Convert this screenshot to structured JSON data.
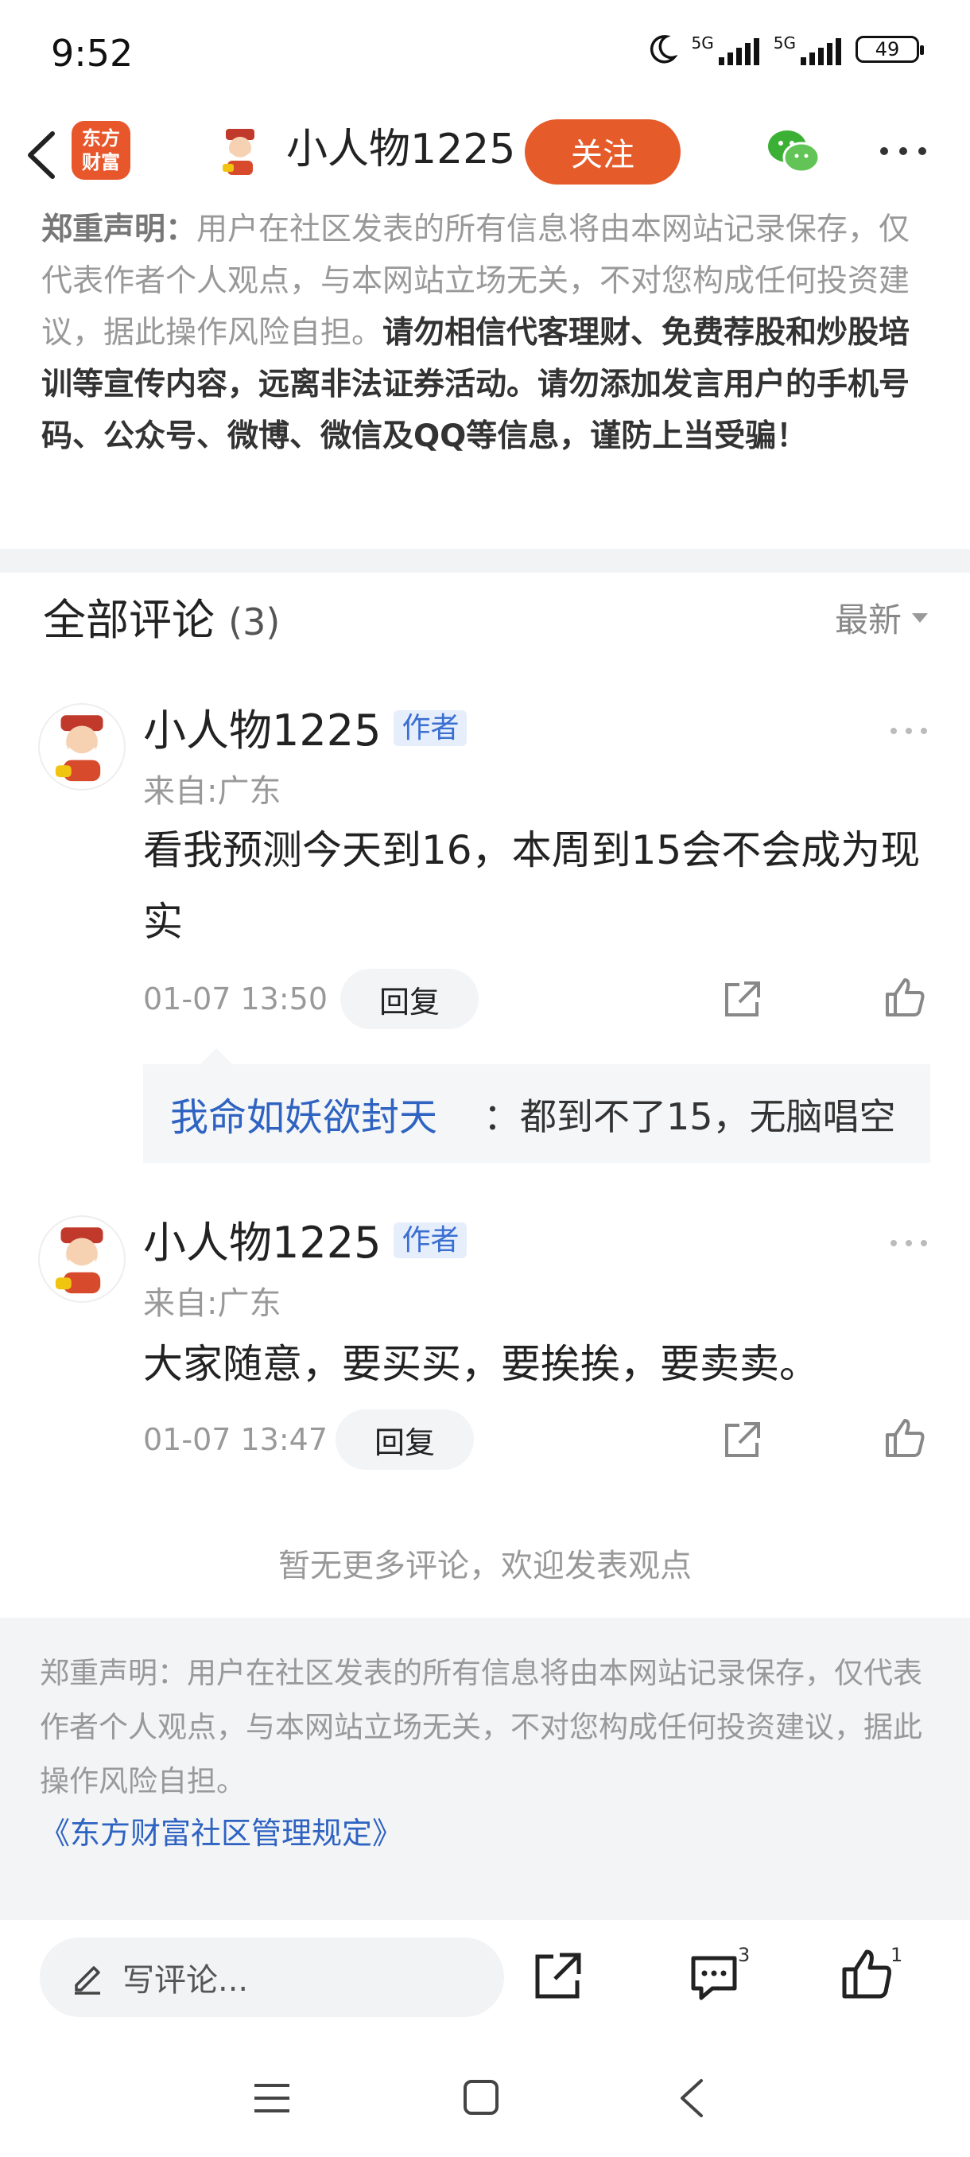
{
  "status_bar": {
    "time": "9:52",
    "network_1": "5G",
    "network_2": "5G",
    "battery": "49"
  },
  "header": {
    "logo_line1": "东方",
    "logo_line2": "财富",
    "username": "小人物1225",
    "follow_label": "关注"
  },
  "disclaimer_top": {
    "lead": "郑重声明：",
    "gray_text": "用户在社区发表的所有信息将由本网站记录保存，仅代表作者个人观点，与本网站立场无关，不对您构成任何投资建议，据此操作风险自担。",
    "dark_text": "请勿相信代客理财、免费荐股和炒股培训等宣传内容，远离非法证券活动。请勿添加发言用户的手机号码、公众号、微博、微信及QQ等信息，谨防上当受骗！"
  },
  "comments_section": {
    "title": "全部评论",
    "count": "(3)",
    "sort_label": "最新"
  },
  "comments": [
    {
      "name": "小人物1225",
      "badge": "作者",
      "location": "来自:广东",
      "text": "看我预测今天到16，本周到15会不会成为现实",
      "time": "01-07 13:50",
      "reply_label": "回复",
      "reply": {
        "user": "我命如妖欲封天",
        "text": "：都到不了15，无脑唱空"
      }
    },
    {
      "name": "小人物1225",
      "badge": "作者",
      "location": "来自:广东",
      "text": "大家随意，要买买，要挨挨，要卖卖。",
      "time": "01-07 13:47",
      "reply_label": "回复"
    }
  ],
  "no_more": "暂无更多评论，欢迎发表观点",
  "disclaimer_bottom": {
    "text": "郑重声明：用户在社区发表的所有信息将由本网站记录保存，仅代表作者个人观点，与本网站立场无关，不对您构成任何投资建议，据此操作风险自担。",
    "rules_link": "《东方财富社区管理规定》"
  },
  "bottom_bar": {
    "write_placeholder": "写评论...",
    "comment_count": "3",
    "like_count": "1"
  },
  "colors": {
    "accent": "#e65b2a",
    "link": "#2e63c2"
  }
}
